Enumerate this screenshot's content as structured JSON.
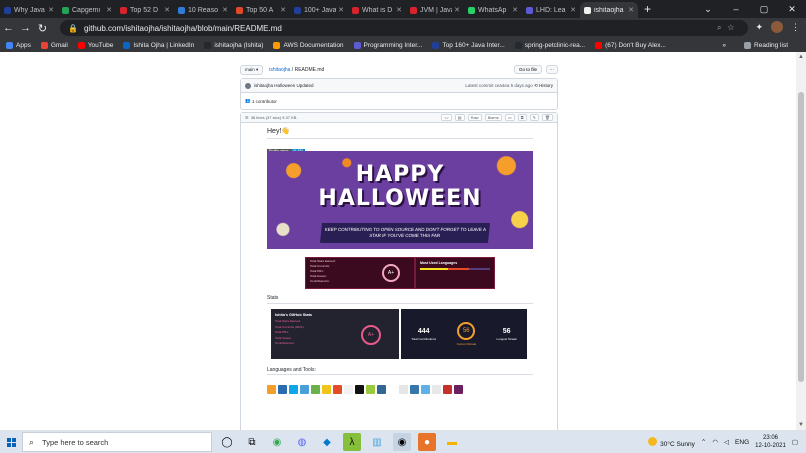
{
  "tabs": [
    {
      "title": "Why Java",
      "color": "#1f3f99"
    },
    {
      "title": "Capgemi",
      "color": "#23a455"
    },
    {
      "title": "Top 52 D",
      "color": "#d8232a"
    },
    {
      "title": "10 Reaso",
      "color": "#2f7bd6"
    },
    {
      "title": "Top 50 A",
      "color": "#e14a26"
    },
    {
      "title": "100+ Java",
      "color": "#1f3f99"
    },
    {
      "title": "What is D",
      "color": "#d8232a"
    },
    {
      "title": "JVM | Java",
      "color": "#d8232a"
    },
    {
      "title": "WhatsAp",
      "color": "#25d366"
    },
    {
      "title": "LHD: Lea",
      "color": "#5b5bd6"
    },
    {
      "title": "ishitaojha",
      "color": "#f0f0f0"
    }
  ],
  "address": {
    "url": "github.com/ishitaojha/ishitaojha/blob/main/README.md"
  },
  "bookmarks": [
    {
      "label": "Apps",
      "color": "#4285f4"
    },
    {
      "label": "Gmail",
      "color": "#ea4335"
    },
    {
      "label": "YouTube",
      "color": "#ff0000"
    },
    {
      "label": "Ishita Ojha | LinkedIn",
      "color": "#0a66c2"
    },
    {
      "label": "ishitaojha (Ishita)",
      "color": "#24292f"
    },
    {
      "label": "AWS Documentation",
      "color": "#ff9900"
    },
    {
      "label": "Programming Inter...",
      "color": "#5b5bd6"
    },
    {
      "label": "Top 160+ Java Inter...",
      "color": "#1f3f99"
    },
    {
      "label": "spring-petclinic-rea...",
      "color": "#24292f"
    },
    {
      "label": "(67) Don't Buy Alex...",
      "color": "#ff0000"
    }
  ],
  "reading_list": "Reading list",
  "github": {
    "branch": "main",
    "crumb_repo": "ishitaojha",
    "crumb_file": "README.md",
    "goto_file": "Go to file",
    "commit_user": "ishitaojha",
    "commit_msg": "Halloween Updated",
    "commit_meta": "Latest commit cea4ea 5 days ago",
    "history": "History",
    "contributors": "1 contributor",
    "file_info": "38 lines (37 sloc)   9.37 KB",
    "raw": "Raw",
    "blame": "Blame"
  },
  "readme": {
    "greeting": "Hey!👋",
    "badge_label": "Profile views",
    "badge_value": "96,884",
    "halloween_title_1": "HAPPY",
    "halloween_title_2": "HALLOWEEN",
    "halloween_banner": "KEEP CONTRIBUTING TO OPEN SOURCE AND DON'T FORGET TO LEAVE A STAR IF YOU'VE COME THIS FAR",
    "rank_lines": [
      "Total Stars Earned:",
      "Total Commits:",
      "Total PRs:",
      "Total Issues:",
      "Contributed to:"
    ],
    "rank_grade": "A+",
    "lang_card_title": "Most Used Languages",
    "stats_heading": "Stats",
    "gh_stats_title": "Ishita's GitHub Stats",
    "gh_stats_lines": [
      "Total Stars Earned:",
      "Total Commits (2021):",
      "Total PRs:",
      "Total Issues:",
      "Contributed to:"
    ],
    "gh_grade": "A+",
    "total_contributions": "444",
    "total_contributions_label": "Total Contributions",
    "current_streak": "56",
    "current_streak_label": "Current Streak",
    "longest_streak": "56",
    "longest_streak_label": "Longest Streak",
    "languages_heading": "Languages and Tools:",
    "tool_icons": [
      "#f59e2b",
      "#2b6cb0",
      "#0ea5e9",
      "#4a9fd8",
      "#6bb04a",
      "#f0c419",
      "#e34c26",
      "#f1f1f1",
      "#111111",
      "#9ac93b",
      "#336791",
      "#ffffff",
      "#e6e6e6",
      "#3776ab",
      "#5fb0e6",
      "#e8e8e8",
      "#c6302b",
      "#6b1f5e"
    ]
  },
  "taskbar": {
    "search_placeholder": "Type here to search",
    "weather": "30°C  Sunny",
    "lang": "ENG",
    "time": "23:06",
    "date": "12-10-2021"
  }
}
